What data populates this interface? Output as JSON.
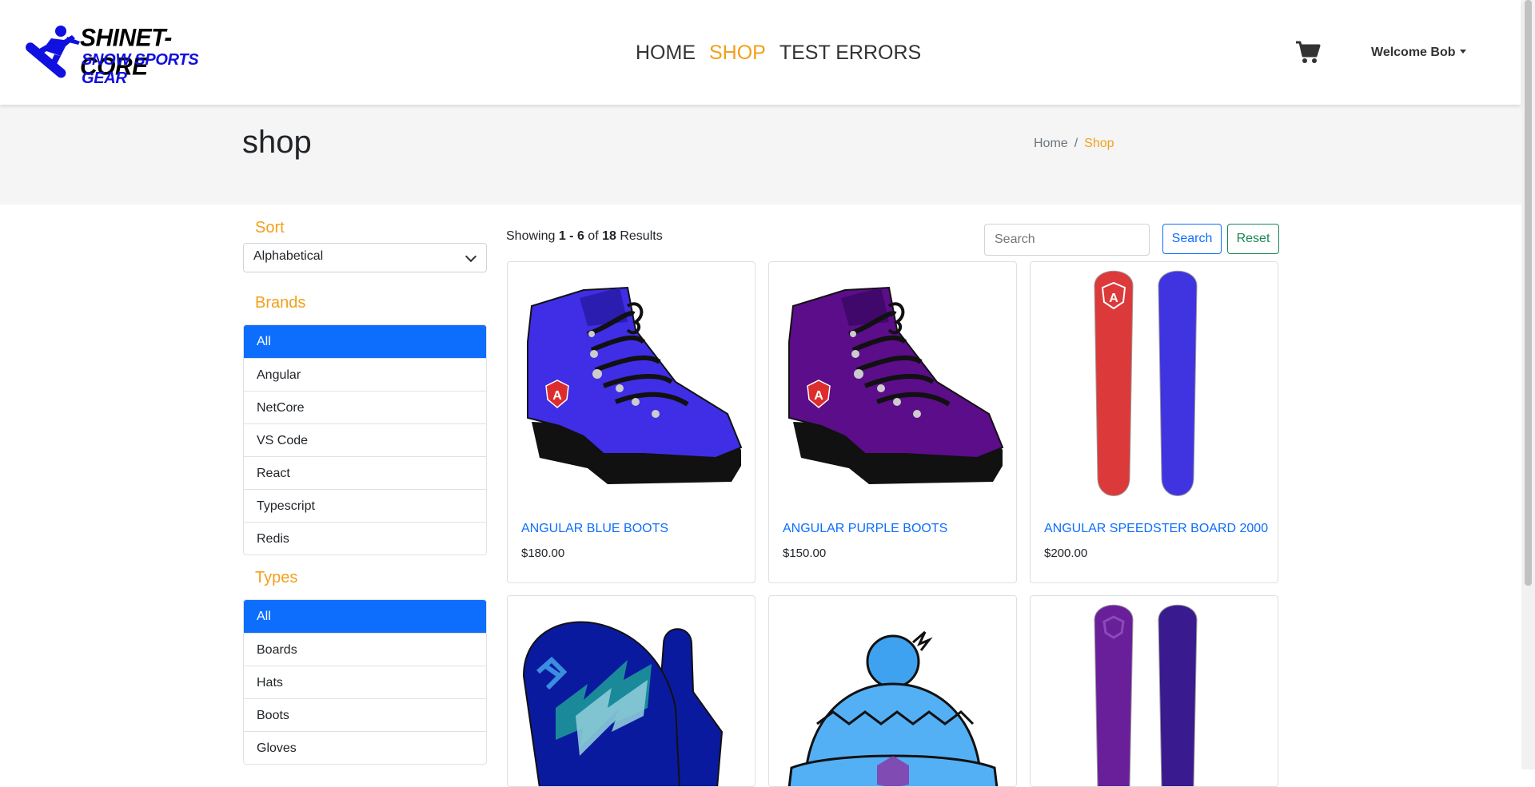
{
  "brand": {
    "line1": "SHINET-CORE",
    "line2": "SNOW SPORTS GEAR"
  },
  "nav": {
    "links": [
      {
        "label": "HOME"
      },
      {
        "label": "SHOP"
      },
      {
        "label": "TEST ERRORS"
      }
    ],
    "active": "SHOP"
  },
  "user": {
    "welcome": "Welcome Bob"
  },
  "header": {
    "title": "shop",
    "breadcrumb": [
      "Home",
      "Shop"
    ]
  },
  "sidebar": {
    "sort_heading": "Sort",
    "sort_selected": "Alphabetical",
    "brands_heading": "Brands",
    "brands": [
      "All",
      "Angular",
      "NetCore",
      "VS Code",
      "React",
      "Typescript",
      "Redis"
    ],
    "types_heading": "Types",
    "types": [
      "All",
      "Boards",
      "Hats",
      "Boots",
      "Gloves"
    ]
  },
  "results": {
    "prefix": "Showing",
    "range": "1 - 6",
    "of": "of",
    "total": "18",
    "suffix": "Results"
  },
  "search": {
    "placeholder": "Search",
    "search_label": "Search",
    "reset_label": "Reset"
  },
  "products": [
    {
      "name": "Angular Blue Boots",
      "price": "$180.00",
      "icon": "blue-boot"
    },
    {
      "name": "Angular Purple Boots",
      "price": "$150.00",
      "icon": "purple-boot"
    },
    {
      "name": "Angular Speedster Board 2000",
      "price": "$200.00",
      "icon": "red-blue-boards"
    },
    {
      "name": "",
      "price": "",
      "icon": "blue-gloves"
    },
    {
      "name": "",
      "price": "",
      "icon": "blue-hat"
    },
    {
      "name": "",
      "price": "",
      "icon": "purple-boards"
    }
  ],
  "colors": {
    "accent": "#f2a01a",
    "primary": "#0d6efd",
    "success": "#198754"
  }
}
